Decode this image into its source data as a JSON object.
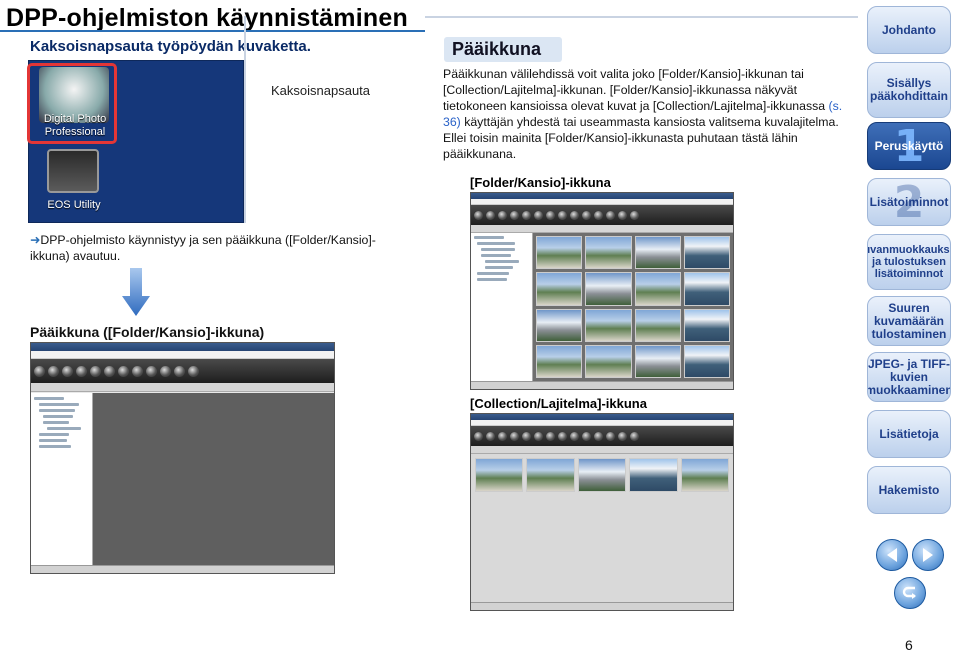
{
  "header": {
    "title": "DPP-ohjelmiston käynnistäminen",
    "subtitle": "Kaksoisnapsauta työpöydän kuvaketta."
  },
  "desktop": {
    "icon1_label": "Digital Photo Professional",
    "icon2_label": "EOS Utility",
    "double_click_label": "Kaksoisnapsauta"
  },
  "result": {
    "arrow_symbol": "➜",
    "text": "DPP-ohjelmisto käynnistyy ja sen pääikkuna ([Folder/Kansio]-ikkuna) avautuu.",
    "main_window_label": "Pääikkuna ([Folder/Kansio]-ikkuna)"
  },
  "section": {
    "title": "Pääikkuna",
    "desc_part1": "Pääikkunan välilehdissä voit valita joko [Folder/Kansio]-ikkunan tai [Collection/Lajitelma]-ikkunan. [Folder/Kansio]-ikkunassa näkyvät tietokoneen kansioissa olevat kuvat ja [Collection/Lajitelma]-ikkunassa ",
    "desc_link": "(s. 36)",
    "desc_part2": " käyttäjän yhdestä tai useammasta kansiosta valitsema kuvalajitelma. Ellei toisin mainita [Folder/Kansio]-ikkunasta puhutaan tästä lähin pääikkunana.",
    "folder_window_label": "[Folder/Kansio]-ikkuna",
    "collection_window_label": "[Collection/Lajitelma]-ikkuna"
  },
  "nav": {
    "intro": "Johdanto",
    "contents": "Sisällys pääkohdittain",
    "basic_num": "1",
    "basic": "Peruskäyttö",
    "advanced_num": "2",
    "advanced": "Lisätoiminnot",
    "image_editing": "Kuvanmuokkauksen ja tulostuksen lisätoiminnot",
    "large_print": "Suuren kuvamäärän tulostaminen",
    "jpeg_tiff": "JPEG- ja TIFF-kuvien muokkaaminen",
    "more_info": "Lisätietoja",
    "index": "Hakemisto"
  },
  "page_number": "6",
  "colors": {
    "accent": "#2a6fb6",
    "nav_active": "#1b4791",
    "link": "#2a62c8",
    "highlight_frame": "#e33636"
  }
}
